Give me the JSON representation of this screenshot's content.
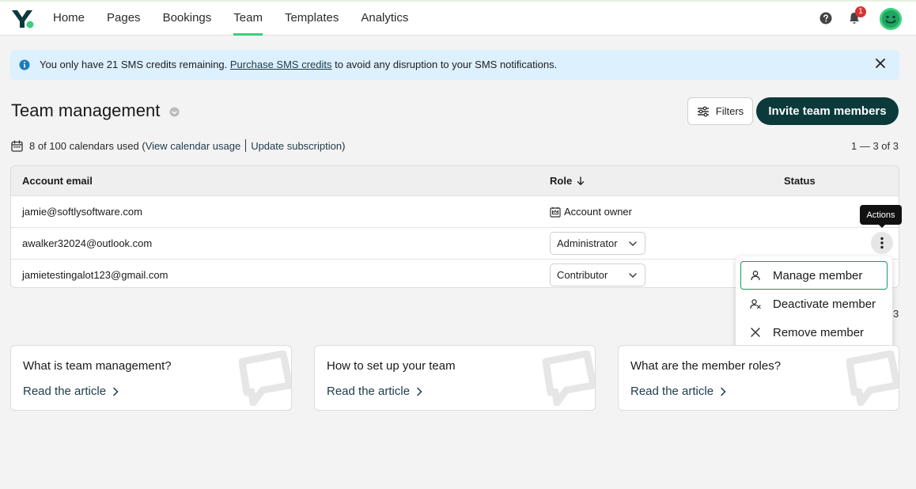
{
  "nav": {
    "items": [
      {
        "label": "Home",
        "active": false
      },
      {
        "label": "Pages",
        "active": false
      },
      {
        "label": "Bookings",
        "active": false
      },
      {
        "label": "Team",
        "active": true
      },
      {
        "label": "Templates",
        "active": false
      },
      {
        "label": "Analytics",
        "active": false
      }
    ],
    "notification_count": "1",
    "icons": {
      "logo": "app-logo-icon",
      "help": "help-icon",
      "bell": "bell-icon",
      "avatar": "avatar-smiley-icon"
    },
    "accent": "#3ccf7d"
  },
  "banner": {
    "text_before": "You only have 21 SMS credits remaining.",
    "link_text": "Purchase SMS credits",
    "text_after": "to avoid any disruption to your SMS notifications."
  },
  "header": {
    "title": "Team management",
    "filters_label": "Filters",
    "invite_label": "Invite team members"
  },
  "usage": {
    "text": "8 of 100 calendars used",
    "link_view": "View calendar usage",
    "link_update": "Update subscription"
  },
  "pagination": {
    "top": "1 — 3 of 3",
    "bottom": "3"
  },
  "table": {
    "columns": {
      "email": "Account email",
      "role": "Role",
      "status": "Status"
    },
    "rows": [
      {
        "email": "jamie@softlysoftware.com",
        "role": "Account owner",
        "role_type": "owner"
      },
      {
        "email": "awalker32024@outlook.com",
        "role": "Administrator",
        "role_type": "select"
      },
      {
        "email": "jamietestingalot123@gmail.com",
        "role": "Contributor",
        "role_type": "select"
      }
    ]
  },
  "tooltip": {
    "label": "Actions"
  },
  "actions_menu": {
    "items": [
      {
        "label": "Manage member",
        "icon": "user-icon"
      },
      {
        "label": "Deactivate member",
        "icon": "user-deactivate-icon"
      },
      {
        "label": "Remove member",
        "icon": "x-icon"
      }
    ]
  },
  "cards": [
    {
      "title": "What is team management?",
      "link": "Read the article"
    },
    {
      "title": "How to set up your team",
      "link": "Read the article"
    },
    {
      "title": "What are the member roles?",
      "link": "Read the article"
    }
  ],
  "colors": {
    "primary": "#0c3a3b",
    "banner_bg": "#dcf0fd",
    "badge": "#d93333"
  }
}
